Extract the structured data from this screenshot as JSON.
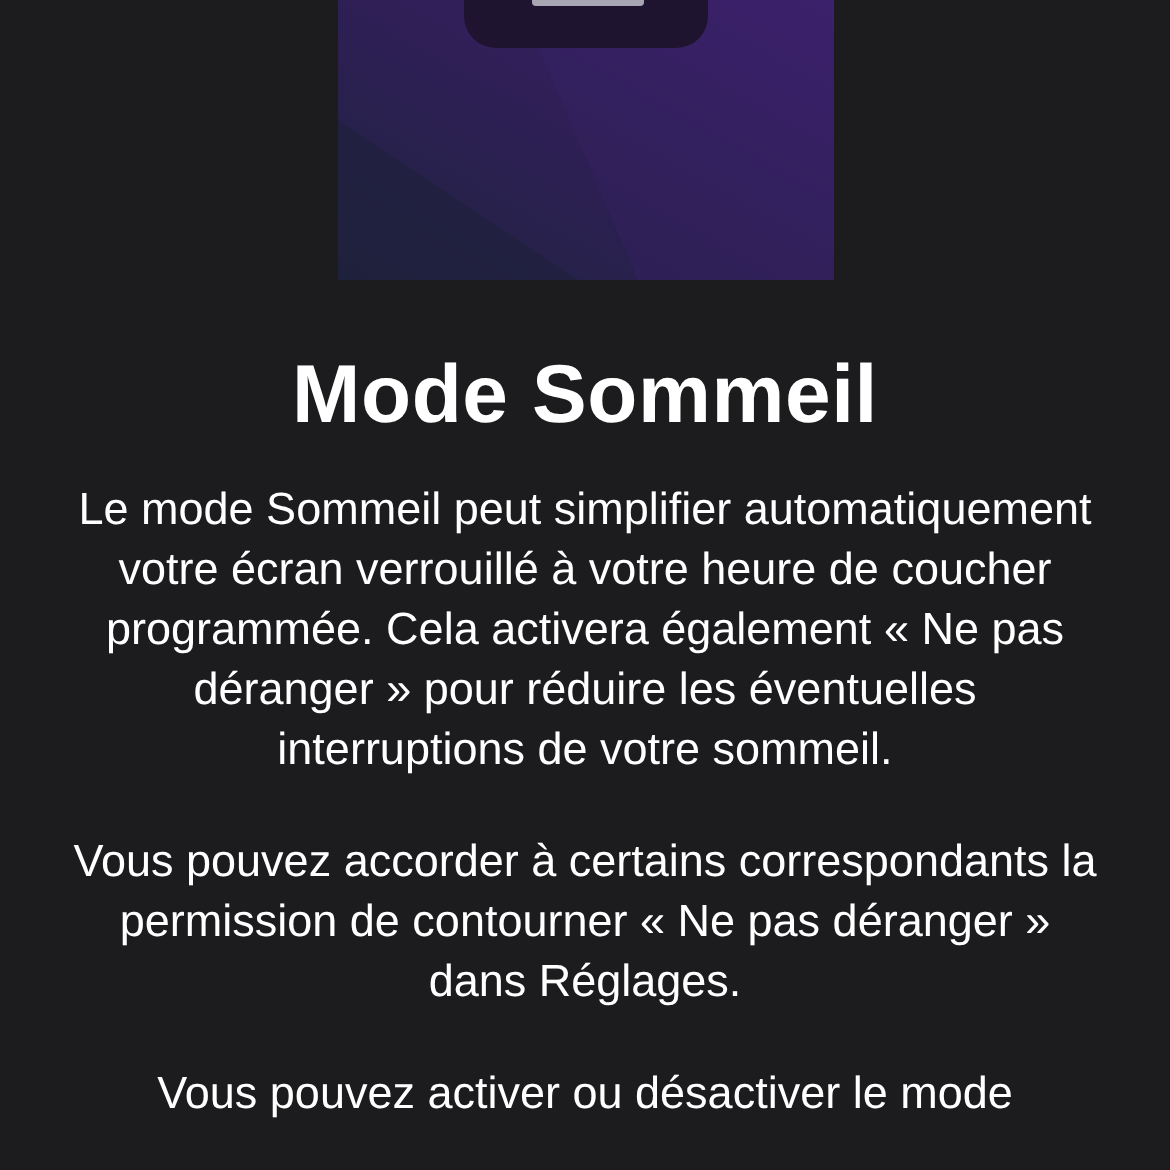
{
  "title": "Mode Sommeil",
  "paragraphs": [
    "Le mode Sommeil peut simplifier automatiquement votre écran verrouillé à votre heure de coucher programmée. Cela activera également « Ne pas déranger » pour réduire les éventuelles interruptions de votre sommeil.",
    "Vous pouvez accorder à certains correspondants la permission de contourner « Ne pas déranger » dans Réglages.",
    "Vous pouvez activer ou désactiver le mode"
  ]
}
